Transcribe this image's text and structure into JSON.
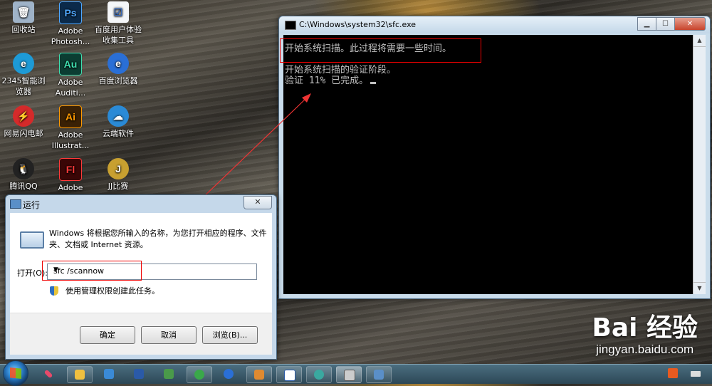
{
  "desktop": {
    "icons": [
      {
        "label": "回收站",
        "glyph": "🗑",
        "color": "#9fb3c8"
      },
      {
        "label": "Adobe Photosh...",
        "glyph": "Ps",
        "color": "#0b2a4a"
      },
      {
        "label": "百度用户体验收集工具",
        "glyph": "☑",
        "color": "#f4f6f8"
      },
      {
        "label": "2345智能浏览器",
        "glyph": "e",
        "color": "#1d9ad6"
      },
      {
        "label": "Adobe Auditi...",
        "glyph": "Au",
        "color": "#0b3d32"
      },
      {
        "label": "百度浏览器",
        "glyph": "e",
        "color": "#2a6fd6"
      },
      {
        "label": "网易闪电邮",
        "glyph": "⚡",
        "color": "#d42a2a"
      },
      {
        "label": "Adobe Illustrat...",
        "glyph": "Ai",
        "color": "#3a2105"
      },
      {
        "label": "云端软件",
        "glyph": "☁",
        "color": "#2a8ad6"
      },
      {
        "label": "腾讯QQ",
        "glyph": "🐧",
        "color": "#222"
      },
      {
        "label": "Adobe",
        "glyph": "Fl",
        "color": "#3a0606"
      },
      {
        "label": "JJ比赛",
        "glyph": "J",
        "color": "#c8a030"
      }
    ]
  },
  "cmd": {
    "title": "C:\\Windows\\system32\\sfc.exe",
    "lines": [
      "开始系统扫描。此过程将需要一些时间。",
      "",
      "开始系统扫描的验证阶段。",
      "验证 11% 已完成。"
    ],
    "progress_percent": 11
  },
  "run": {
    "title": "运行",
    "description": "Windows 将根据您所输入的名称，为您打开相应的程序、文件夹、文档或 Internet 资源。",
    "open_label": "打开(O):",
    "command_value": "sfc /scannow",
    "admin_note": "使用管理权限创建此任务。",
    "ok_label": "确定",
    "cancel_label": "取消",
    "browse_label": "浏览(B)..."
  },
  "watermark": {
    "logo": "Bai 经验",
    "url": "jingyan.baidu.com"
  }
}
